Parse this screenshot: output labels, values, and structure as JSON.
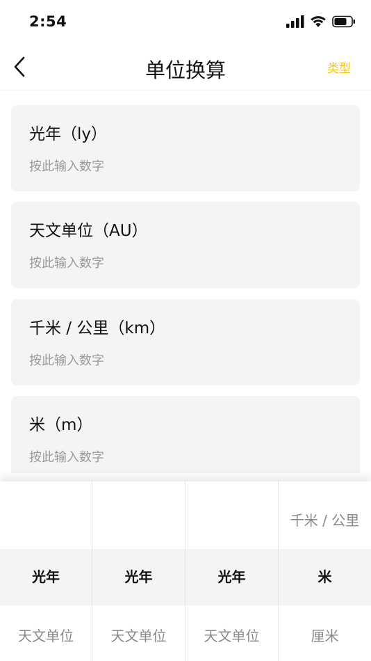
{
  "status": {
    "time": "2:54"
  },
  "nav": {
    "title": "单位换算",
    "action": "类型"
  },
  "units": [
    {
      "label": "光年（ly）",
      "placeholder": "按此输入数字"
    },
    {
      "label": "天文单位（AU）",
      "placeholder": "按此输入数字"
    },
    {
      "label": "千米 / 公里（km）",
      "placeholder": "按此输入数字"
    },
    {
      "label": "米（m）",
      "placeholder": "按此输入数字"
    }
  ],
  "picker": {
    "columns": [
      {
        "prev": "",
        "selected": "光年",
        "next": "天文单位"
      },
      {
        "prev": "",
        "selected": "光年",
        "next": "天文单位"
      },
      {
        "prev": "",
        "selected": "光年",
        "next": "天文单位"
      },
      {
        "prev": "千米 / 公里",
        "selected": "米",
        "next": "厘米"
      }
    ]
  },
  "colors": {
    "accent": "#f4c21a",
    "card": "#f4f4f4",
    "placeholder": "#999999"
  }
}
